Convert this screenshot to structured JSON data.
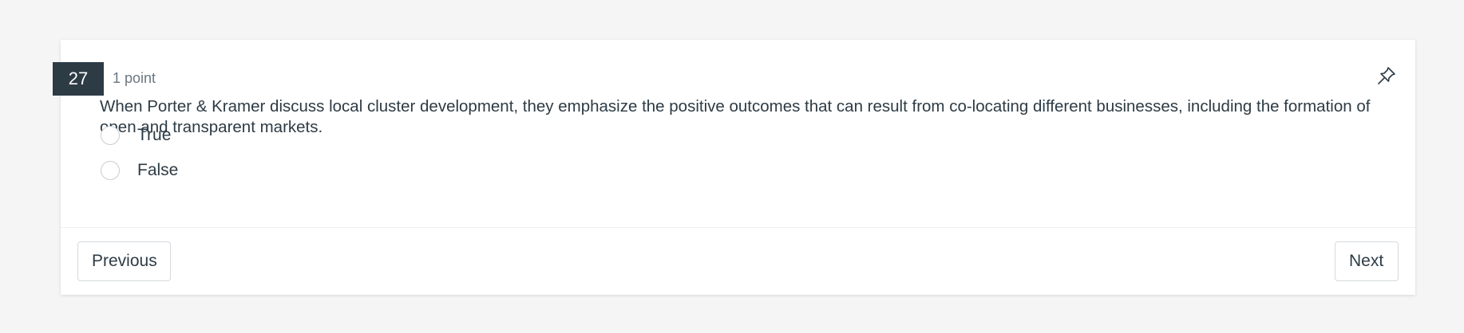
{
  "question": {
    "number": "27",
    "points": "1 point",
    "text": "When Porter & Kramer discuss local cluster development, they emphasize the positive outcomes that can result from co-locating different businesses, including the formation of open and transparent markets.",
    "options": [
      {
        "label": "True",
        "selected": false
      },
      {
        "label": "False",
        "selected": false
      }
    ],
    "pin_icon": "pin-icon"
  },
  "navigation": {
    "previous_label": "Previous",
    "next_label": "Next"
  },
  "colors": {
    "badge_background": "#2d3b45",
    "page_background": "#f5f5f5",
    "text": "#2d3b45"
  }
}
